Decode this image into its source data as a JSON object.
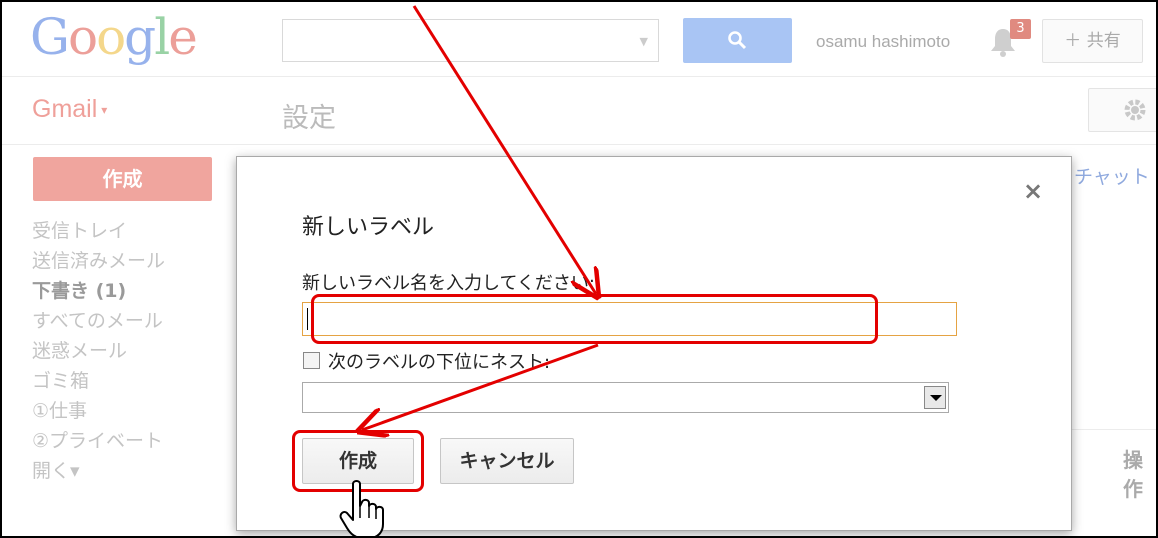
{
  "header": {
    "logo_letters": [
      "G",
      "o",
      "o",
      "g",
      "l",
      "e"
    ],
    "user_name": "osamu hashimoto",
    "notification_count": "3",
    "share_label": "＋ 共有"
  },
  "subheader": {
    "app_name": "Gmail",
    "app_caret": "▾",
    "page_title": "設定"
  },
  "sidebar": {
    "compose_label": "作成",
    "items": [
      {
        "label": "受信トレイ"
      },
      {
        "label": "送信済みメール"
      },
      {
        "label": "下書き (1)"
      },
      {
        "label": "すべてのメール"
      },
      {
        "label": "迷惑メール"
      },
      {
        "label": "ゴミ箱"
      },
      {
        "label": "①仕事"
      },
      {
        "label": "②プライベート"
      },
      {
        "label": "開く▾"
      }
    ]
  },
  "right_panel": {
    "chat_label": "チャット",
    "ops_label": "操作"
  },
  "dialog": {
    "close_label": "×",
    "title": "新しいラベル",
    "name_prompt": "新しいラベル名を入力してください:",
    "name_value": "",
    "nest_label": "次のラベルの下位にネスト:",
    "nest_checked": false,
    "parent_selected": "",
    "create_label": "作成",
    "cancel_label": "キャンセル"
  },
  "colors": {
    "annotation": "#e30000",
    "input_focus_border": "#e5a343",
    "compose_button": "#f0a59e"
  }
}
